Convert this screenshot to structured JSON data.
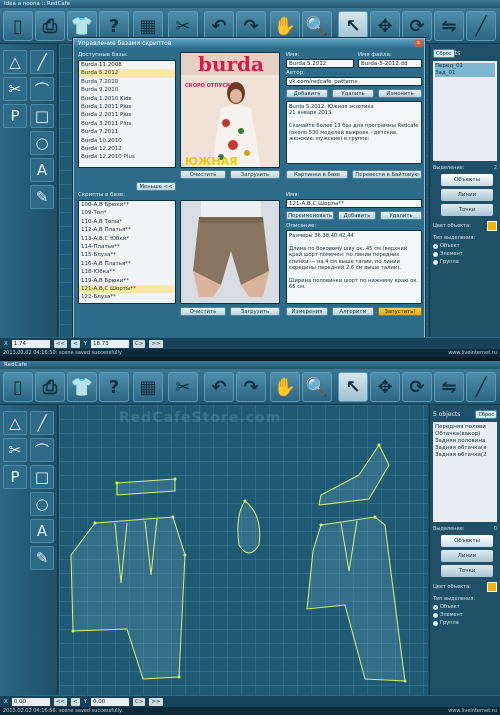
{
  "window1": {
    "title": "Idea a noona :: RedCafe",
    "status": "2013.02.02 04:16:50: scene saved successfully",
    "coords": {
      "x_label": "X",
      "x_value": "1.74",
      "y_label": "Y",
      "y_value": "18.73",
      "prev": "<<",
      "prev2": "<",
      "next": "C>",
      "next2": ">>"
    },
    "right_panel": {
      "count": "2 objects",
      "sbros": "Сброс",
      "items": [
        "Перед_01",
        "Зад_01"
      ],
      "selected_label": "Выделение:",
      "selected_value": "2",
      "btn_objects": "Объекты",
      "btn_lines": "Линии",
      "btn_points": "Точки",
      "color_label": "Цвет объекта:",
      "type_label": "Тип выделения:",
      "radios": [
        "Объект",
        "Элемент",
        "Группа"
      ]
    },
    "dialog": {
      "title": "Управление базами скриптов",
      "close": "x",
      "db_label": "Доступные базы:",
      "db_list": [
        "Burda 11.2008",
        "Burda 5.2012",
        "Burda 7.2010",
        "Burda 9.2010",
        "Burda 1.2010 Kids",
        "Burda 1.2011 Plus",
        "Burda 2.2011 Plus",
        "Burda 3.2011 Plus",
        "Burda 7.2011",
        "Burda 10.2010",
        "Burda 12.2012",
        "Burda 12.2010 Plus"
      ],
      "db_selected_index": 1,
      "name_label": "Имя:",
      "name_value": "Burda 5.2012",
      "file_label": "Имя файла:",
      "file_value": "Burda-5-2012.dd",
      "author_label": "Автор:",
      "author_value": "vk.com/redcafe_patterns",
      "btn_add": "Добавить",
      "btn_delete": "Удалить",
      "btn_edit": "Изменить",
      "description1": "Burda 5.2012. Южная экзотика\n21 января 2013.\n\nСкачайте более 13 баз для программы Redcafe (около 530 моделей выкроек - детские, женские, мужские) в группе:",
      "btn_clear": "Очистить",
      "btn_load": "Загрузить",
      "btn_pictures": "Картинки в базе",
      "btn_move": "Перевести в Байтовую",
      "smaller": "Меньше <<",
      "scripts_label": "Скрипты в базе:",
      "scripts_list": [
        "100-А,В Брюки**",
        "109-Топ*",
        "110-А,В Топы*",
        "112-А,В Платья**",
        "113-А,В,С Юбки*",
        "114-Платье**",
        "115-Блуза**",
        "116-А,В Платья**",
        "118-Юбка**",
        "119-А,В Брюки**",
        "121-А,В,С Шорты**",
        "122-Блуза**"
      ],
      "scripts_selected_index": 10,
      "script_name_label": "Имя:",
      "script_name_value": "121-А,В,С Шорты**",
      "btn_rename": "Переименовать",
      "btn_add2": "Добавить",
      "btn_delete2": "Удалить",
      "desc2_label": "Описание:",
      "description2": "Размеры 36,38,40,42,44\n\nДлина по боковому шву ок. 45 см (верхний край шорт помечен: по линии передних спинки — на 4 см выше талии, по линии середины передней 2,6 см выше талии).\n\nШирина половинки шорт по нижнему краю ок. 65 см.",
      "btn_clear2": "Очистить",
      "btn_load2": "Загрузить",
      "btn_measure": "Измерения",
      "btn_algo": "Алгоритм",
      "btn_run": "Запустить!",
      "magazine_brand": "burda",
      "magazine_tag": "ЮЖНАЯ",
      "magazine_spring": "СКОРО ОТПУСК!"
    }
  },
  "window2": {
    "title": "RedCafe",
    "watermark": "RedCafeStore.com",
    "status": "2013.02.02 04:16:56: scene saved successfully",
    "coords": {
      "x_label": "X",
      "x_value": "0.00",
      "y_label": "Y",
      "y_value": "0.00",
      "prev": "<<",
      "prev2": "<",
      "next": "C>",
      "next2": ">>"
    },
    "right_panel": {
      "count": "5 objects",
      "sbros": "Сброс",
      "items": [
        "Передняя полови",
        "Обтачка(вакор)",
        "Задняя половина",
        "Задняя обтачка(я",
        "Задняя обтачка(2"
      ],
      "selected_label": "Выделение:",
      "selected_value": "0",
      "btn_objects": "Объекты",
      "btn_lines": "Линии",
      "btn_points": "Точки",
      "color_label": "Цвет объекта:",
      "type_label": "Тип выделения:",
      "radios": [
        "Объект",
        "Элемент",
        "Группа"
      ]
    }
  },
  "watermark_site": "www.liveinternet.ru",
  "colors": {
    "accent": "#f2b200",
    "pattern_line": "#d8f070",
    "panel": "#1f5068"
  }
}
